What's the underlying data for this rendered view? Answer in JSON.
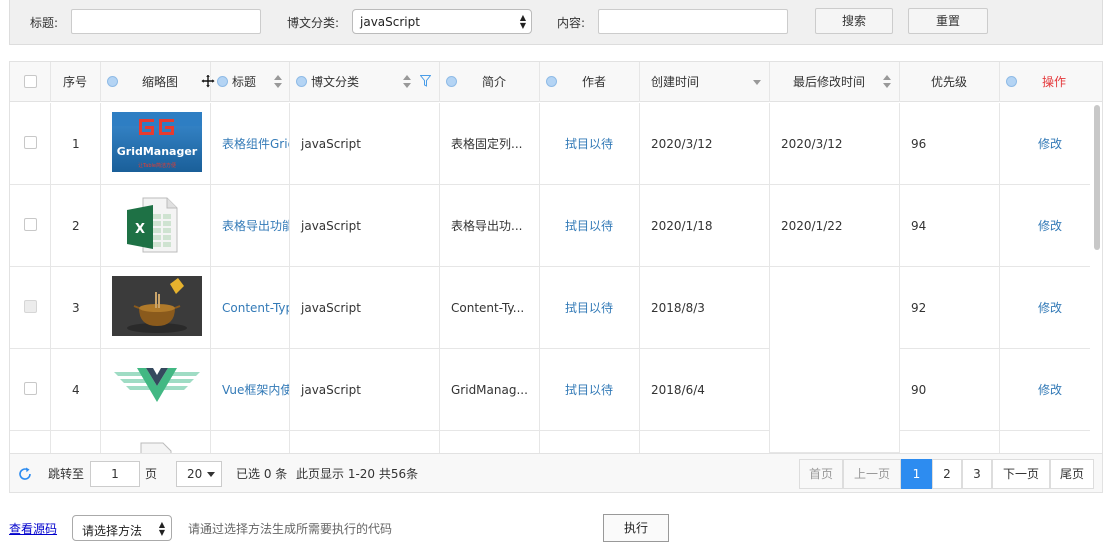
{
  "search": {
    "title_label": "标题:",
    "category_label": "博文分类:",
    "category_value": "javaScript",
    "content_label": "内容:",
    "search_button": "搜索",
    "reset_button": "重置"
  },
  "table": {
    "columns": {
      "index": "序号",
      "thumbnail": "缩略图",
      "title": "标题",
      "category": "博文分类",
      "summary": "简介",
      "author": "作者",
      "created": "创建时间",
      "modified": "最后修改时间",
      "priority": "优先级",
      "action": "操作"
    },
    "rows": [
      {
        "index": "1",
        "title": "表格组件Grid",
        "category": "javaScript",
        "summary": "表格固定列...",
        "author": "拭目以待",
        "created": "2020/3/12",
        "modified": "2020/3/12",
        "priority": "96",
        "action": "修改"
      },
      {
        "index": "2",
        "title": "表格导出功能",
        "category": "javaScript",
        "summary": "表格导出功...",
        "author": "拭目以待",
        "created": "2020/1/18",
        "modified": "2020/1/22",
        "priority": "94",
        "action": "修改"
      },
      {
        "index": "3",
        "title": "Content-Type",
        "category": "javaScript",
        "summary": "Content-Ty...",
        "author": "拭目以待",
        "created": "2018/8/3",
        "modified": "",
        "priority": "92",
        "action": "修改"
      },
      {
        "index": "4",
        "title": "Vue框架内使",
        "category": "javaScript",
        "summary": "GridManag...",
        "author": "拭目以待",
        "created": "2018/6/4",
        "modified": "",
        "priority": "90",
        "action": "修改"
      }
    ],
    "thumb1_text": "GridManager",
    "thumb1_sub": "让Table简洁方便",
    "action_color": "#e4393c",
    "link_color": "#337ab7"
  },
  "footer": {
    "goto_label": "跳转至",
    "goto_value": "1",
    "page_unit": "页",
    "page_size": "20",
    "selected_text": "已选 0 条",
    "info_text": "此页显示 1-20 共56条",
    "first": "首页",
    "prev": "上一页",
    "pages": [
      "1",
      "2",
      "3"
    ],
    "next": "下一页",
    "last": "尾页"
  },
  "bottom": {
    "source_link": "查看源码",
    "method_select": "请选择方法",
    "hint": "请通过选择方法生成所需要执行的代码",
    "run_button": "执行"
  }
}
